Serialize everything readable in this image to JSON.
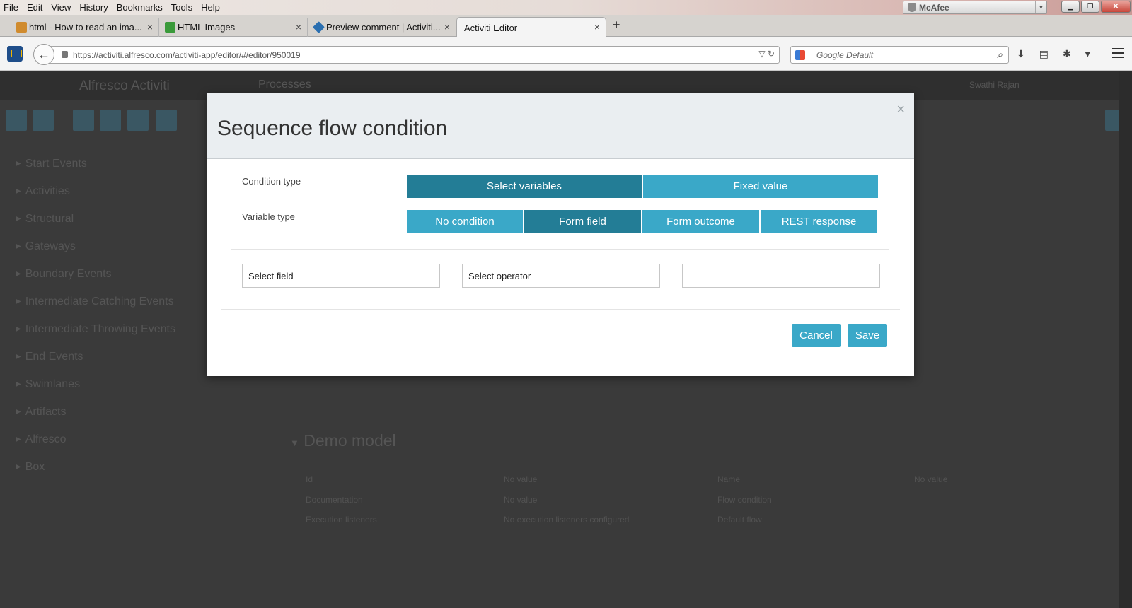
{
  "menubar": {
    "items": [
      "File",
      "Edit",
      "View",
      "History",
      "Bookmarks",
      "Tools",
      "Help"
    ],
    "mcafee_label": "McAfee"
  },
  "tabs": [
    {
      "title": "html - How to read an ima...",
      "favicon_color": "#d08b2e"
    },
    {
      "title": "HTML Images",
      "favicon_color": "#3a9a3a"
    },
    {
      "title": "Preview comment | Activiti...",
      "favicon_color": "#2a6fb0"
    },
    {
      "title": "Activiti Editor",
      "favicon_color": ""
    }
  ],
  "navbar": {
    "url": "https://activiti.alfresco.com/activiti-app/editor/#/editor/950019",
    "search_placeholder": "Google Default"
  },
  "app": {
    "logo": "Alfresco Activiti",
    "nav_item": "Processes",
    "user": "Swathi Rajan",
    "palette": [
      "Start Events",
      "Activities",
      "Structural",
      "Gateways",
      "Boundary Events",
      "Intermediate Catching Events",
      "Intermediate Throwing Events",
      "End Events",
      "Swimlanes",
      "Artifacts",
      "Alfresco",
      "Box"
    ],
    "model_title": "Demo model",
    "props": {
      "id_label": "Id",
      "id_value": "No value",
      "doc_label": "Documentation",
      "doc_value": "No value",
      "exec_label": "Execution listeners",
      "exec_value": "No execution listeners configured",
      "name_label": "Name",
      "name_value": "No value",
      "flow_label": "Flow condition",
      "default_label": "Default flow"
    }
  },
  "modal": {
    "title": "Sequence flow condition",
    "close_glyph": "×",
    "condition_type_label": "Condition type",
    "condition_type_options": [
      "Select variables",
      "Fixed value"
    ],
    "condition_type_selected": "Select variables",
    "variable_type_label": "Variable type",
    "variable_type_options": [
      "No condition",
      "Form field",
      "Form outcome",
      "REST response"
    ],
    "variable_type_selected": "Form field",
    "field_select": "Select field",
    "operator_select": "Select operator",
    "value_input": "",
    "cancel_label": "Cancel",
    "save_label": "Save"
  },
  "colors": {
    "button": "#3aa8c8",
    "button_active": "#237d96",
    "modal_header": "#eaeef1"
  }
}
